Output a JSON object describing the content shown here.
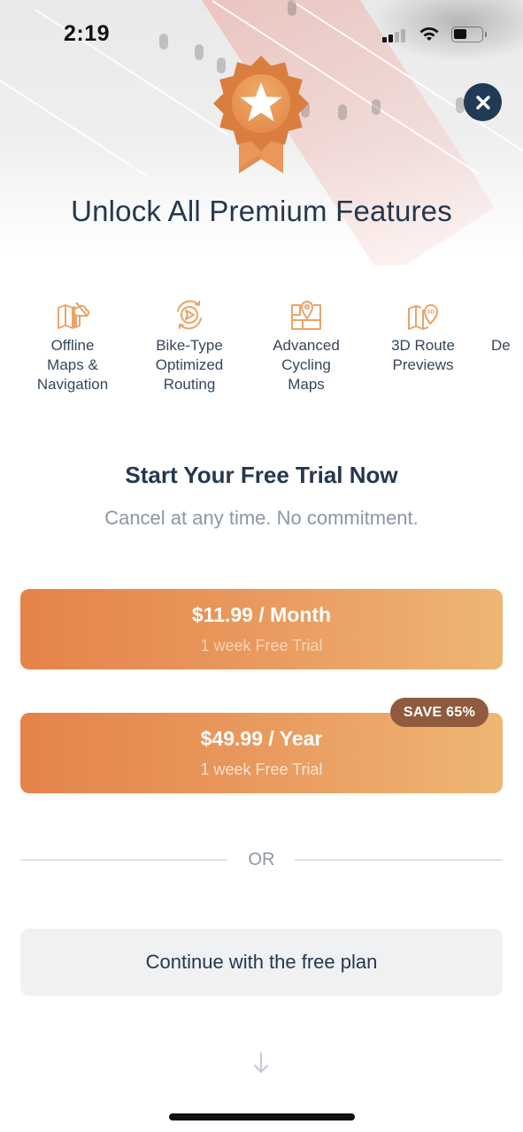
{
  "status_bar": {
    "time": "2:19",
    "signal_icon": "cellular-signal-icon",
    "wifi_icon": "wifi-icon",
    "battery_icon": "battery-icon"
  },
  "header": {
    "close_icon": "close-icon",
    "badge_icon": "premium-star-badge-icon",
    "title": "Unlock All Premium Features"
  },
  "features": [
    {
      "icon": "offline-map-icon",
      "label_lines": [
        "Offline",
        "Maps &",
        "Navigation"
      ]
    },
    {
      "icon": "routing-icon",
      "label_lines": [
        "Bike-Type",
        "Optimized",
        "Routing"
      ]
    },
    {
      "icon": "cycling-map-pin-icon",
      "label_lines": [
        "Advanced",
        "Cycling",
        "Maps"
      ]
    },
    {
      "icon": "3d-route-map-icon",
      "label_lines": [
        "3D Route",
        "Previews"
      ]
    },
    {
      "icon": "",
      "label_lines": [
        "De"
      ]
    }
  ],
  "trial": {
    "title": "Start Your Free Trial Now",
    "subtitle": "Cancel at any time. No commitment."
  },
  "plans": [
    {
      "price": "$11.99 / Month",
      "trial": "1 week Free Trial"
    },
    {
      "price": "$49.99 / Year",
      "trial": "1 week Free Trial",
      "badge": "SAVE 65%"
    }
  ],
  "divider": {
    "label": "OR"
  },
  "free_plan": {
    "label": "Continue with the free plan"
  },
  "scroll_hint_icon": "arrow-down-icon",
  "colors": {
    "accent_start": "#e4834a",
    "accent_end": "#efb673",
    "badge_bg": "#8f5a3d",
    "navy": "#24384f",
    "close_bg": "#213a56",
    "muted_text": "#8a97a5",
    "free_btn_bg": "#eff1f3"
  }
}
